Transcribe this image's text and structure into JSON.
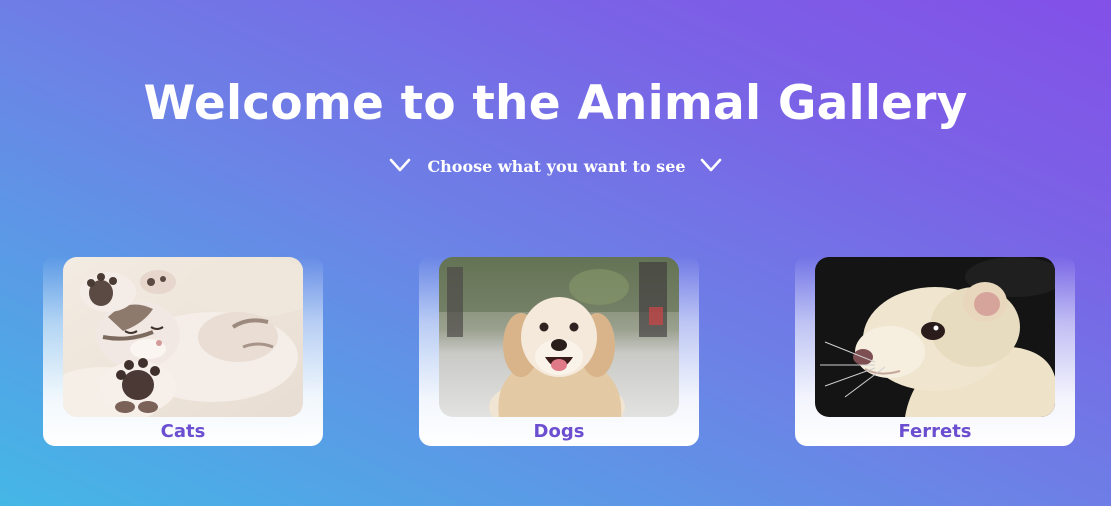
{
  "header": {
    "title": "Welcome to the Animal Gallery",
    "subtitle": "Choose what you want to see"
  },
  "gallery": {
    "cards": [
      {
        "label": "Cats",
        "image": "sleeping-kitten-photo"
      },
      {
        "label": "Dogs",
        "image": "golden-retriever-photo"
      },
      {
        "label": "Ferrets",
        "image": "ferret-photo"
      }
    ]
  },
  "colors": {
    "gradient_start": "#44b7e6",
    "gradient_end": "#8350e8",
    "label_color": "#6b4fd0",
    "title_color": "#ffffff"
  }
}
